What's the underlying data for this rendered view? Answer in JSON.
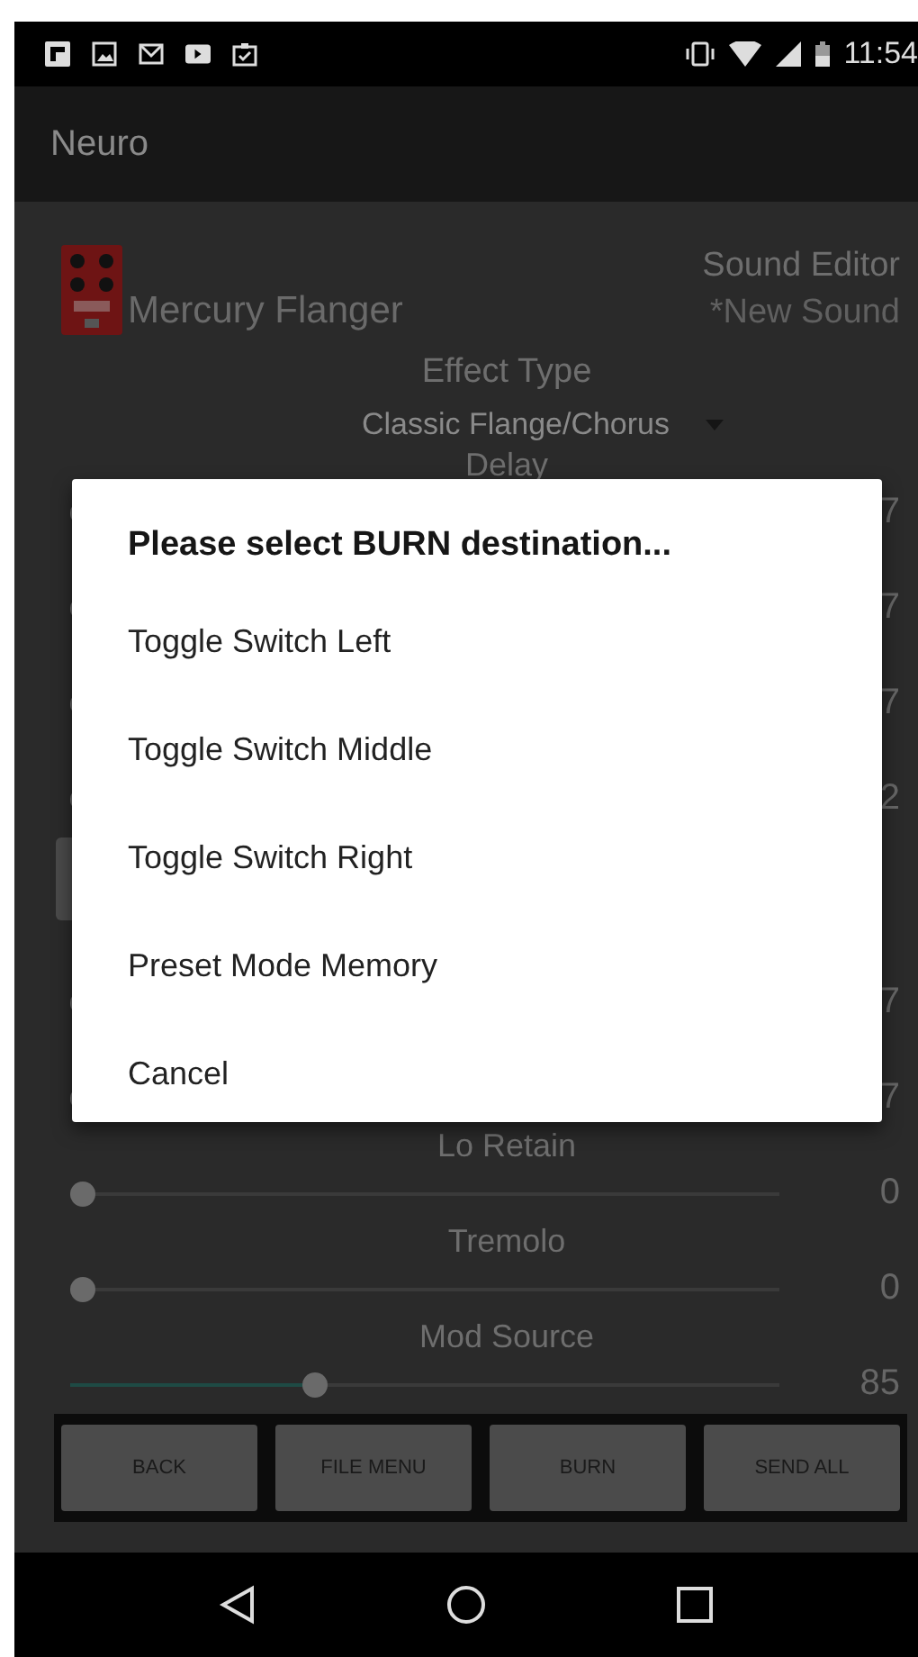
{
  "status_bar": {
    "time": "11:54"
  },
  "app_bar": {
    "title": "Neuro"
  },
  "effect": {
    "name": "Mercury Flanger",
    "mode": "Sound Editor",
    "sound": "*New Sound"
  },
  "effect_type": {
    "label": "Effect Type",
    "value": "Classic Flange/Chorus"
  },
  "controls": [
    {
      "kind": "slider",
      "label": "Delay",
      "value": "7",
      "level": 0
    },
    {
      "kind": "slider",
      "value": "7",
      "level": 0
    },
    {
      "kind": "slider",
      "value": "7",
      "level": 0
    },
    {
      "kind": "slider",
      "value": "2",
      "level": 0
    },
    {
      "kind": "button"
    },
    {
      "kind": "slider",
      "value": "7",
      "level": 0
    },
    {
      "kind": "slider",
      "value": "7",
      "level": 0
    },
    {
      "kind": "slider",
      "label": "Lo Retain",
      "value": "0",
      "level": 0
    },
    {
      "kind": "slider",
      "label": "Tremolo",
      "value": "0",
      "level": 0
    },
    {
      "kind": "slider",
      "label": "Mod Source",
      "value": "85",
      "level": 0.34
    }
  ],
  "buttons": [
    "BACK",
    "FILE MENU",
    "BURN",
    "SEND ALL"
  ],
  "dialog": {
    "title": "Please select BURN destination...",
    "options": [
      "Toggle Switch Left",
      "Toggle Switch Middle",
      "Toggle Switch Right",
      "Preset Mode Memory",
      "Cancel"
    ]
  }
}
